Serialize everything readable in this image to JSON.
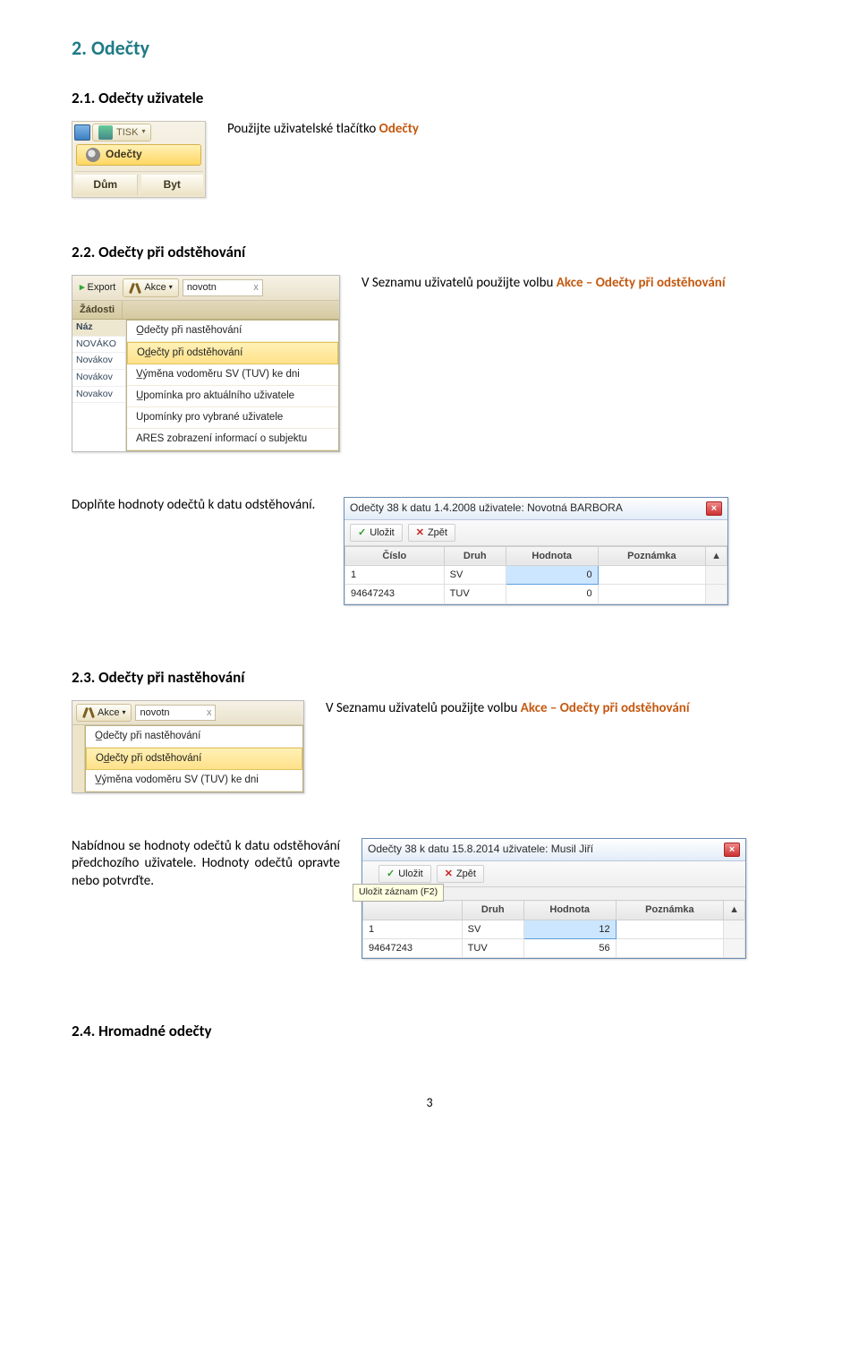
{
  "title": "2. Odečty",
  "s21": {
    "heading": "2.1. Odečty uživatele",
    "text_prefix": "Použijte uživatelské tlačítko ",
    "text_link": "Odečty",
    "ribbon": {
      "tisk": "TISK",
      "odecty": "Odečty",
      "dum": "Dům",
      "byt": "Byt"
    }
  },
  "s22": {
    "heading": "2.2. Odečty při odstěhování",
    "para_prefix": "V Seznamu uživatelů použijte volbu ",
    "para_link": "Akce – Odečty při odstěhování",
    "menu": {
      "export": "Export",
      "akce": "Akce",
      "search_val": "novotn",
      "clear": "x",
      "tabs": [
        "Žádosti"
      ],
      "names": [
        "Náz",
        "NOVÁKO",
        "Novákov",
        "Novákov",
        "Novakov"
      ],
      "items": [
        "O̲dečty při nastěhování",
        "Od̲ečty při odstěhování",
        "V̲ýměna vodoměru SV (TUV) ke dni",
        "U̲pomínka pro aktuálního uživatele",
        "Upomínky pro vybrané uživatele",
        "ARES   zobrazení informací o subjektu"
      ],
      "hover_index": 1
    },
    "fill_text": "Doplňte hodnoty odečtů k datu odstěhování.",
    "dialog": {
      "title": "Odečty 38 k datu 1.4.2008 uživatele: Novotná BARBORA",
      "save": "Uložit",
      "undo": "Zpět",
      "cols": [
        "Číslo",
        "Druh",
        "Hodnota",
        "Poznámka"
      ],
      "rows": [
        {
          "cislo": "1",
          "druh": "SV",
          "hodnota": "0",
          "pozn": "",
          "sel": true
        },
        {
          "cislo": "94647243",
          "druh": "TUV",
          "hodnota": "0",
          "pozn": ""
        }
      ]
    }
  },
  "s23": {
    "heading": "2.3. Odečty při nastěhování",
    "para_prefix": "V Seznamu uživatelů použijte volbu ",
    "para_link": "Akce – Odečty při odstěhování",
    "menu": {
      "akce": "Akce",
      "search_val": "novotn",
      "clear": "x",
      "items": [
        "O̲dečty při nastěhování",
        "Od̲ečty při odstěhování",
        "V̲ýměna vodoměru SV (TUV) ke dni"
      ],
      "hover_index": 1
    },
    "fill_text": "Nabídnou se hodnoty odečtů k datu odstěhování předchozího uživatele. Hodnoty odečtů opravte nebo potvrďte.",
    "dialog": {
      "title": "Odečty 38 k datu 15.8.2014 uživatele: Musil Jiří",
      "save": "Uložit",
      "undo": "Zpět",
      "tooltip": "Uložit záznam (F2)",
      "cols": [
        "",
        "Druh",
        "Hodnota",
        "Poznámka"
      ],
      "rows": [
        {
          "cislo": "1",
          "druh": "SV",
          "hodnota": "12",
          "pozn": "",
          "sel": true
        },
        {
          "cislo": "94647243",
          "druh": "TUV",
          "hodnota": "56",
          "pozn": ""
        }
      ]
    }
  },
  "s24": {
    "heading": "2.4. Hromadné odečty"
  },
  "page_num": "3"
}
